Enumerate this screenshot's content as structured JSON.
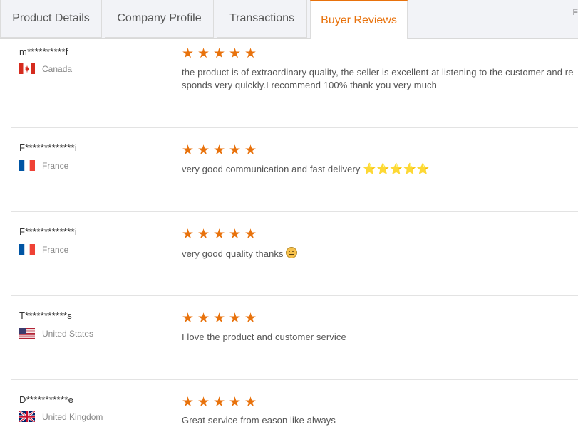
{
  "tabs": [
    {
      "label": "Product Details",
      "active": false
    },
    {
      "label": "Company Profile",
      "active": false
    },
    {
      "label": "Transactions",
      "active": false
    },
    {
      "label": "Buyer Reviews",
      "active": true
    }
  ],
  "edge_char": "F",
  "accent_color": "#e8720c",
  "reviews": [
    {
      "name": "m**********f",
      "country": "Canada",
      "flag": "canada-flag",
      "rating": 5,
      "text": "the product is of extraordinary quality, the seller is excellent at listening to the customer and responds very quickly.I recommend 100% thank you very much"
    },
    {
      "name": "F*************i",
      "country": "France",
      "flag": "france-flag",
      "rating": 5,
      "text": "very good communication and fast delivery",
      "suffix_stars": 5
    },
    {
      "name": "F*************i",
      "country": "France",
      "flag": "france-flag",
      "rating": 5,
      "text": "very good quality thanks",
      "suffix_emoji": "slightly-frowning-face"
    },
    {
      "name": "T***********s",
      "country": "United States",
      "flag": "usa-flag",
      "rating": 5,
      "text": "I love the product and customer service"
    },
    {
      "name": "D***********e",
      "country": "United Kingdom",
      "flag": "uk-flag",
      "rating": 5,
      "text": "Great service from eason like always"
    }
  ]
}
